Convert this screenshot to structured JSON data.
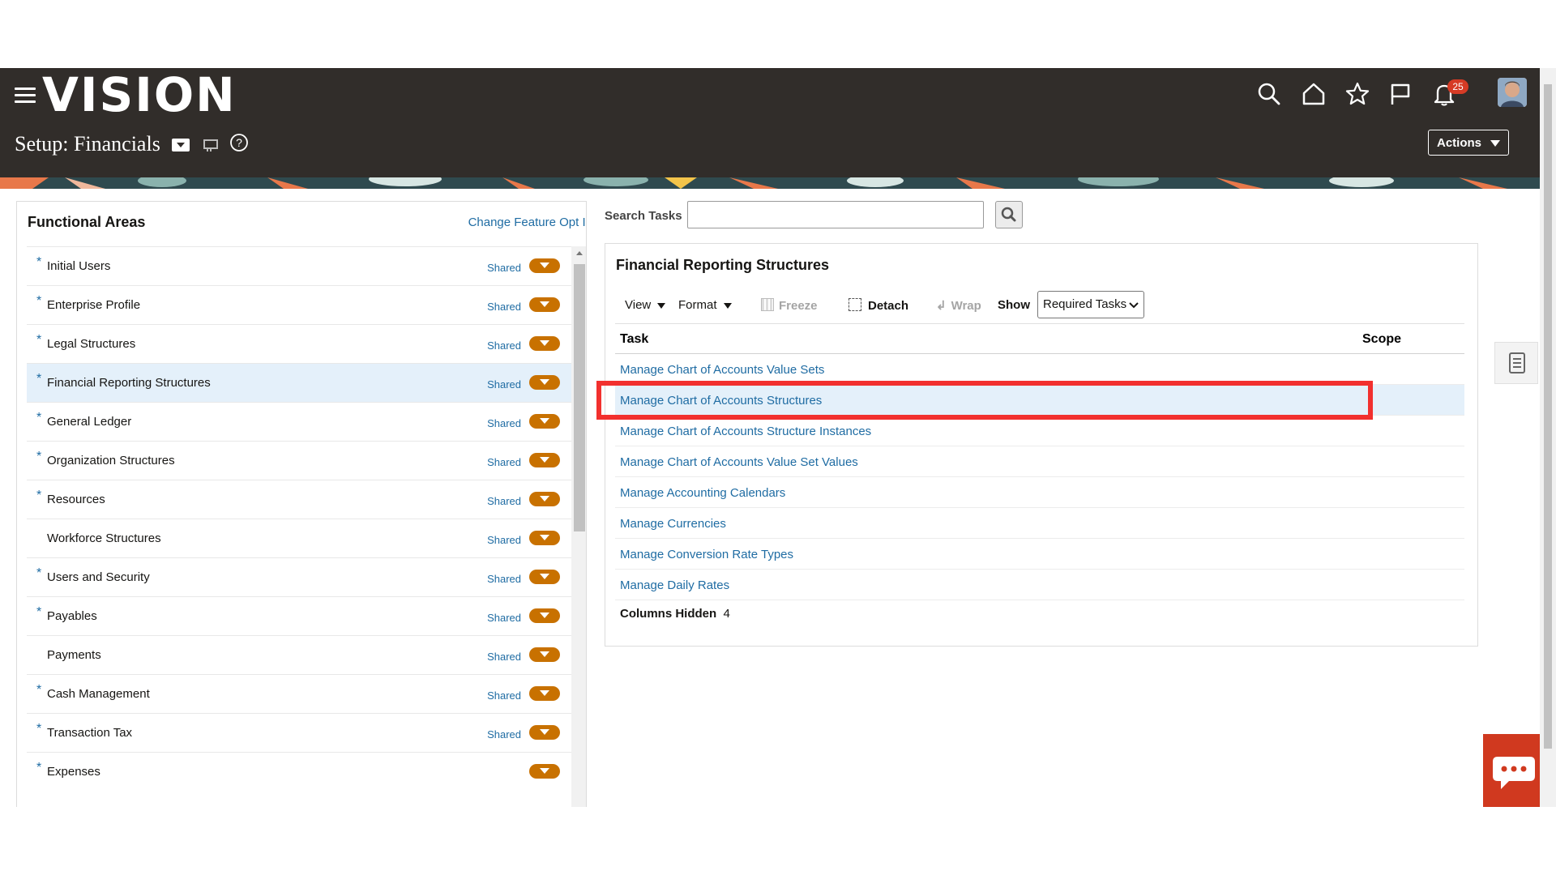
{
  "header": {
    "logo": "VISION",
    "page_title": "Setup: Financials",
    "notification_count": "25",
    "actions_label": "Actions",
    "icons": [
      "hamburger-menu-icon",
      "search-icon",
      "home-icon",
      "star-icon",
      "flag-icon",
      "bell-icon"
    ],
    "background_color": "#312d2a"
  },
  "functional_areas": {
    "title": "Functional Areas",
    "change_link": "Change Feature Opt In",
    "items": [
      {
        "label": "Initial Users",
        "required": true,
        "shared": "Shared"
      },
      {
        "label": "Enterprise Profile",
        "required": true,
        "shared": "Shared"
      },
      {
        "label": "Legal Structures",
        "required": true,
        "shared": "Shared"
      },
      {
        "label": "Financial Reporting Structures",
        "required": true,
        "shared": "Shared",
        "selected": true
      },
      {
        "label": "General Ledger",
        "required": true,
        "shared": "Shared"
      },
      {
        "label": "Organization Structures",
        "required": true,
        "shared": "Shared"
      },
      {
        "label": "Resources",
        "required": true,
        "shared": "Shared"
      },
      {
        "label": "Workforce Structures",
        "required": false,
        "shared": "Shared"
      },
      {
        "label": "Users and Security",
        "required": true,
        "shared": "Shared"
      },
      {
        "label": "Payables",
        "required": true,
        "shared": "Shared"
      },
      {
        "label": "Payments",
        "required": false,
        "shared": "Shared"
      },
      {
        "label": "Cash Management",
        "required": true,
        "shared": "Shared"
      },
      {
        "label": "Transaction Tax",
        "required": true,
        "shared": "Shared"
      },
      {
        "label": "Expenses",
        "required": true,
        "shared": ""
      }
    ]
  },
  "search": {
    "label": "Search Tasks",
    "value": ""
  },
  "tasks_panel": {
    "title": "Financial Reporting Structures",
    "toolbar": {
      "view": "View",
      "format": "Format",
      "freeze": "Freeze",
      "detach": "Detach",
      "wrap": "Wrap",
      "show_label": "Show",
      "show_value": "Required Tasks"
    },
    "columns": {
      "task": "Task",
      "scope": "Scope"
    },
    "rows": [
      {
        "task": "Manage Chart of Accounts Value Sets"
      },
      {
        "task": "Manage Chart of Accounts Structures",
        "selected": true
      },
      {
        "task": "Manage Chart of Accounts Structure Instances"
      },
      {
        "task": "Manage Chart of Accounts Value Set Values"
      },
      {
        "task": "Manage Accounting Calendars"
      },
      {
        "task": "Manage Currencies"
      },
      {
        "task": "Manage Conversion Rate Types"
      },
      {
        "task": "Manage Daily Rates"
      }
    ],
    "columns_hidden_label": "Columns Hidden",
    "columns_hidden_count": "4"
  },
  "colors": {
    "link": "#1f6ca3",
    "accent_orange": "#c87100",
    "highlight_red": "#f2302e",
    "selected_bg": "#e4f0fa"
  }
}
